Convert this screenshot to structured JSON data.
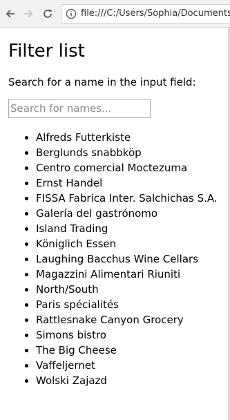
{
  "browser": {
    "url": "file:///C:/Users/Sophia/Documents/"
  },
  "page": {
    "title": "Filter list",
    "instructions": "Search for a name in the input field:",
    "search_placeholder": "Search for names...",
    "search_value": "",
    "names": [
      "Alfreds Futterkiste",
      "Berglunds snabbköp",
      "Centro comercial Moctezuma",
      "Ernst Handel",
      "FISSA Fabrica Inter. Salchichas S.A.",
      "Galería del gastrónomo",
      "Island Trading",
      "Königlich Essen",
      "Laughing Bacchus Wine Cellars",
      "Magazzini Alimentari Riuniti",
      "North/South",
      "Paris spécialités",
      "Rattlesnake Canyon Grocery",
      "Simons bistro",
      "The Big Cheese",
      "Vaffeljernet",
      "Wolski Zajazd"
    ]
  },
  "icons": {
    "back": "back-arrow-icon",
    "forward": "forward-arrow-icon",
    "reload": "reload-icon",
    "info": "info-icon"
  }
}
